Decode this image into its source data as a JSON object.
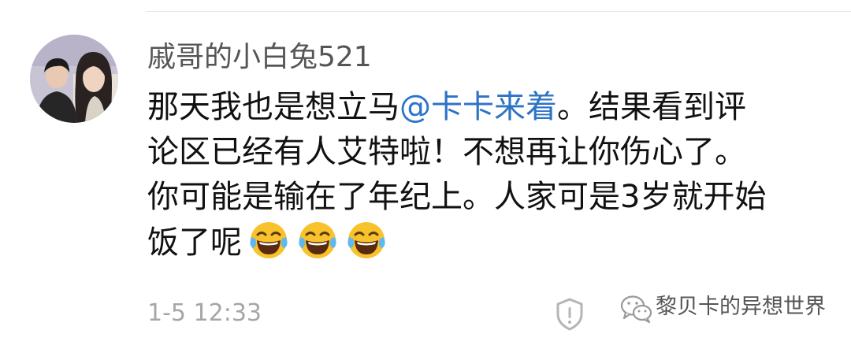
{
  "comment": {
    "username": "戚哥的小白兔521",
    "line1_prefix": "那天我也是想立马",
    "mention": "@卡卡来着",
    "line1_suffix": "。结果看到评",
    "line2": "论区已经有人艾特啦！不想再让你伤心了。",
    "line3": "你可能是输在了年纪上。人家可是3岁就开始",
    "line4": "饭了呢",
    "emojis": [
      "laughing-tears-emoji",
      "laughing-tears-emoji",
      "laughing-tears-emoji"
    ],
    "timestamp": "1-5 12:33"
  },
  "footer": {
    "report_icon": "shield-exclamation-icon",
    "watermark_icon": "wechat-icon",
    "watermark_text": "黎贝卡的异想世界"
  },
  "colors": {
    "mention": "#2d73c6",
    "username": "#555555",
    "body_text": "#111111",
    "timestamp": "#a6a6a6"
  }
}
